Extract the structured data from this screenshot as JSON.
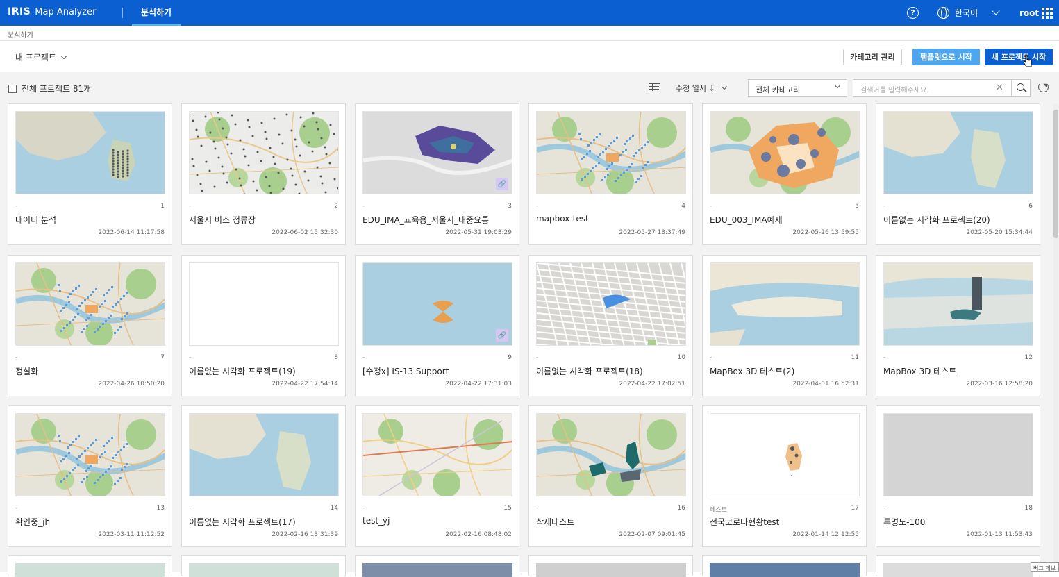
{
  "header": {
    "logo_mark": "IRIS",
    "app_name": "Map Analyzer",
    "nav_tab": "분석하기",
    "help_glyph": "?",
    "language": "한국어",
    "user": "root"
  },
  "breadcrumb": "분석하기",
  "toolbar": {
    "project_selector": "내 프로젝트",
    "category_button": "카테고리 관리",
    "template_button": "템플릿으로 시작",
    "new_project_button": "새 프로젝트 시작"
  },
  "filters": {
    "total_label": "전체 프로젝트 81개",
    "sort_label": "수정 일시 ↓",
    "category_select": "전체 카테고리",
    "search_placeholder": "검색어를 입력해주세요.",
    "clear_glyph": "✕"
  },
  "cards": [
    {
      "category": "-",
      "number": "1",
      "name": "데이터 분석",
      "date": "2022-06-14 11:17:58",
      "thumb": "korea-dots",
      "linked": false
    },
    {
      "category": "-",
      "number": "2",
      "name": "서울시 버스 정류장",
      "date": "2022-06-02 15:32:30",
      "thumb": "bus-stops",
      "linked": false
    },
    {
      "category": "-",
      "number": "3",
      "name": "EDU_IMA_교육용_서울시_대중요통",
      "date": "2022-05-31 19:03:29",
      "thumb": "purple-3d",
      "linked": true
    },
    {
      "category": "-",
      "number": "4",
      "name": "mapbox-test",
      "date": "2022-05-27 13:37:49",
      "thumb": "seoul-blue",
      "linked": false
    },
    {
      "category": "-",
      "number": "5",
      "name": "EDU_003_IMA예제",
      "date": "2022-05-26 13:59:55",
      "thumb": "orange-choropleth",
      "linked": false
    },
    {
      "category": "-",
      "number": "6",
      "name": "이름없는 시각화 프로젝트(20)",
      "date": "2022-05-20 15:34:44",
      "thumb": "korea-plain",
      "linked": false
    },
    {
      "category": "-",
      "number": "7",
      "name": "정설화",
      "date": "2022-04-26 10:50:20",
      "thumb": "seoul-blue",
      "linked": false
    },
    {
      "category": "-",
      "number": "8",
      "name": "이름없는 시각화 프로젝트(19)",
      "date": "2022-04-22 17:54:14",
      "thumb": "blank",
      "linked": false
    },
    {
      "category": "-",
      "number": "9",
      "name": "[수정x] IS-13 Support",
      "date": "2022-04-22 17:31:03",
      "thumb": "orange-sector",
      "linked": true
    },
    {
      "category": "-",
      "number": "10",
      "name": "이름없는 시각화 프로젝트(18)",
      "date": "2022-04-22 17:02:51",
      "thumb": "streets-blue",
      "linked": false
    },
    {
      "category": "-",
      "number": "11",
      "name": "MapBox 3D 테스트(2)",
      "date": "2022-04-01 16:52:31",
      "thumb": "globe-3d",
      "linked": false
    },
    {
      "category": "-",
      "number": "12",
      "name": "MapBox 3D 테스트",
      "date": "2022-03-16 12:58:20",
      "thumb": "tower-3d",
      "linked": false
    },
    {
      "category": "-",
      "number": "13",
      "name": "확인중_jh",
      "date": "2022-03-11 11:12:52",
      "thumb": "seoul-blue",
      "linked": false
    },
    {
      "category": "-",
      "number": "14",
      "name": "이름없는 시각화 프로젝트(17)",
      "date": "2022-02-16 13:31:39",
      "thumb": "korea-plain",
      "linked": false
    },
    {
      "category": "-",
      "number": "15",
      "name": "test_yj",
      "date": "2022-02-16 08:48:02",
      "thumb": "city-map",
      "linked": false
    },
    {
      "category": "-",
      "number": "16",
      "name": "삭제테스트",
      "date": "2022-02-07 09:01:45",
      "thumb": "teal-regions",
      "linked": false
    },
    {
      "category": "테스트",
      "number": "17",
      "name": "전국코로나현황test",
      "date": "2022-01-14 12:12:55",
      "thumb": "korea-small",
      "linked": false
    },
    {
      "category": "-",
      "number": "18",
      "name": "투명도-100",
      "date": "2022-01-13 11:53:43",
      "thumb": "gray",
      "linked": false
    }
  ],
  "bug_report": "버그 제보",
  "colors": {
    "header": "#0b5fd0",
    "accent_light": "#4ea6ef",
    "link_badge": "#d5c6f2"
  }
}
